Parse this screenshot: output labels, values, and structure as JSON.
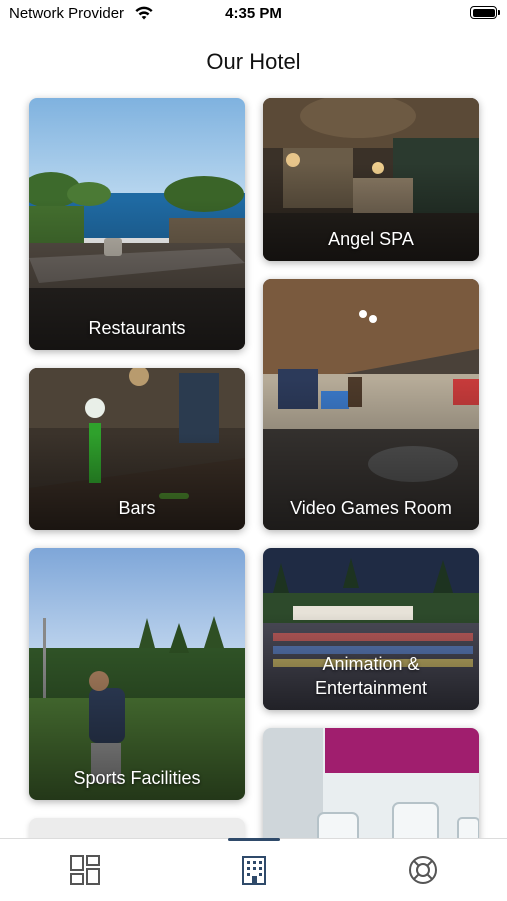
{
  "status_bar": {
    "carrier": "Network Provider",
    "time": "4:35 PM",
    "wifi_icon": "wifi-icon",
    "battery_icon": "battery-icon"
  },
  "header": {
    "title": "Our Hotel"
  },
  "tiles": [
    {
      "label_lines": [
        "Restaurants"
      ]
    },
    {
      "label_lines": [
        "Angel SPA"
      ]
    },
    {
      "label_lines": [
        "Bars"
      ]
    },
    {
      "label_lines": [
        "Video Games Room"
      ]
    },
    {
      "label_lines": [
        "Sports Facilities"
      ]
    },
    {
      "label_lines": [
        "Animation &",
        "Entertainment"
      ]
    },
    {
      "label_lines": []
    },
    {
      "label_lines": []
    }
  ],
  "tab_bar": {
    "selected_index": 1,
    "tabs": [
      {
        "icon": "dashboard-icon"
      },
      {
        "icon": "hotel-building-icon"
      },
      {
        "icon": "lifebuoy-icon"
      }
    ],
    "colors": {
      "icon": "#2f4a6a",
      "inactive": "#555555",
      "indicator": "#2f4a6a"
    }
  }
}
